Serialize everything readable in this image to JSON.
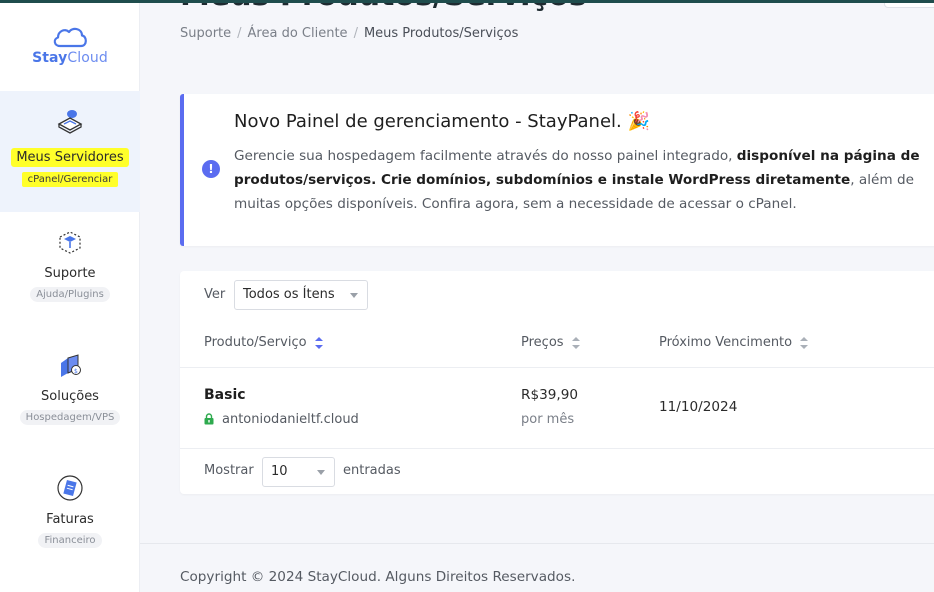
{
  "brand": {
    "name_part1": "Stay",
    "name_part2": "Cloud"
  },
  "sidebar": {
    "items": [
      {
        "label": "Meus Servidores",
        "sub": "cPanel/Gerenciar",
        "icon": "server-icon",
        "active": true
      },
      {
        "label": "Suporte",
        "sub": "Ajuda/Plugins",
        "icon": "support-box-icon"
      },
      {
        "label": "Soluções",
        "sub": "Hospedagem/VPS",
        "icon": "solutions-icon"
      },
      {
        "label": "Faturas",
        "sub": "Financeiro",
        "icon": "invoice-icon"
      }
    ]
  },
  "header": {
    "title": "Meus Produtos/Serviços"
  },
  "breadcrumb": {
    "items": [
      "Suporte",
      "Área do Cliente",
      "Meus Produtos/Serviços"
    ]
  },
  "alert": {
    "title": "Novo Painel de gerenciamento - StayPanel.",
    "emoji": "🎉",
    "text_1": "Gerencie sua hospedagem facilmente através do nosso painel integrado, ",
    "text_bold": "disponível na página de produtos/serviços. Crie domínios, subdomínios e instale WordPress diretamente",
    "text_2": ", além de muitas opções disponíveis. Confira agora, sem a necessidade de acessar o cPanel."
  },
  "table": {
    "filter_label": "Ver",
    "filter_value": "Todos os Ítens",
    "columns": [
      "Produto/Serviço",
      "Preços",
      "Próximo Vencimento"
    ],
    "rows": [
      {
        "product": "Basic",
        "domain": "antoniodanieltf.cloud",
        "price": "R$39,90",
        "period": "por mês",
        "due": "11/10/2024"
      }
    ],
    "show_label": "Mostrar",
    "show_value": "10",
    "entries_label": "entradas"
  },
  "footer": {
    "copyright": "Copyright © 2024 StayCloud. Alguns Direitos Reservados."
  },
  "colors": {
    "accent": "#5b6cf0",
    "brand": "#4a76e8",
    "highlight": "#ffff2a",
    "secure": "#2eaa4e"
  }
}
